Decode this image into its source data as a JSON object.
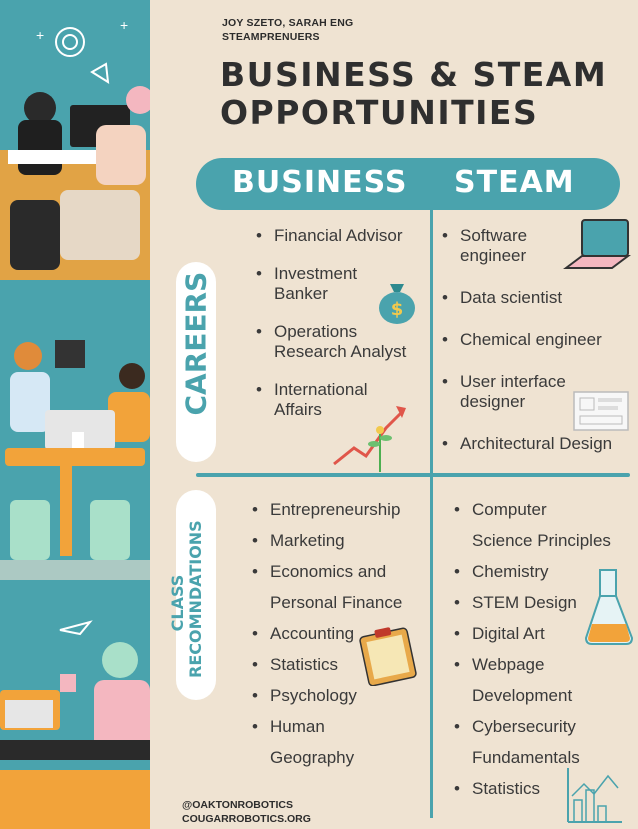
{
  "authors": [
    "JOY SZETO, SARAH ENG",
    "STEAMPRENUERS"
  ],
  "title": [
    "BUSINESS & STEAM",
    "OPPORTUNITIES"
  ],
  "headers": {
    "business": "BUSINESS",
    "steam": "STEAM"
  },
  "section_labels": {
    "careers": "CAREERS",
    "class_line1": "CLASS",
    "class_line2": "RECOMNDATIONS"
  },
  "careers": {
    "business": [
      "Financial Advisor",
      "Investment\nBanker",
      "Operations\nResearch Analyst",
      "International\nAffairs"
    ],
    "steam": [
      "Software\nengineer",
      "Data scientist",
      "Chemical engineer",
      "User interface\ndesigner",
      "Architectural Design"
    ]
  },
  "classes": {
    "business": [
      "Entrepreneurship",
      "Marketing",
      "Economics and\nPersonal Finance",
      "Accounting",
      "Statistics",
      "Psychology",
      "Human\nGeography"
    ],
    "steam": [
      "Computer\nScience Principles",
      "Chemistry",
      "STEM Design",
      "Digital Art",
      "Webpage\nDevelopment",
      "Cybersecurity\nFundamentals",
      "Statistics"
    ]
  },
  "footer": [
    "@OAKTONROBOTICS",
    "COUGARROBOTICS.ORG"
  ],
  "colors": {
    "teal": "#4aa3ad",
    "background": "#efe3d2",
    "text": "#3a3a3a"
  },
  "icons": [
    "money-bag-icon",
    "laptop-icon",
    "growth-chart-icon",
    "wireframe-icon",
    "clipboard-icon",
    "flask-icon",
    "chart-icon"
  ]
}
